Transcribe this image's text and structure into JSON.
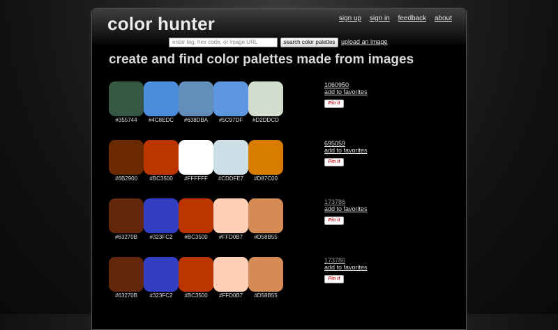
{
  "header": {
    "logo": "color hunter",
    "nav": [
      "sign up",
      "sign in",
      "feedback",
      "about"
    ]
  },
  "search": {
    "placeholder": "enter tag, hex code, or image URL",
    "button_label": "search color palettes",
    "upload_label": "upload an image"
  },
  "headline": "create and find color palettes made from images",
  "palettes": [
    {
      "count": "1060950",
      "count_color": "#e6e6e6",
      "favorite_label": "add to favorites",
      "pin_label": "Pin it",
      "colors": [
        "#355744",
        "#4C8EDC",
        "#638DBA",
        "#5C97DF",
        "#D2DDCD"
      ],
      "labels": [
        "#355744",
        "#4C8EDC",
        "#638DBA",
        "#5C97DF",
        "#D2DDCD"
      ]
    },
    {
      "count": "695059",
      "count_color": "#e6e6e6",
      "favorite_label": "add to favorites",
      "pin_label": "Pin it",
      "colors": [
        "#6B2900",
        "#BC3500",
        "#FFFFFF",
        "#CDDFE7",
        "#D87C00"
      ],
      "labels": [
        "#6B2900",
        "#BC3500",
        "#FFFFFF",
        "#CDDFE7",
        "#D87C00"
      ]
    },
    {
      "count": "173786",
      "count_color": "#9a9a9a",
      "favorite_label": "add to favorites",
      "pin_label": "Pin it",
      "colors": [
        "#63270B",
        "#323FC2",
        "#BC3500",
        "#FFD0B7",
        "#D58B55"
      ],
      "labels": [
        "#63270B",
        "#323FC2",
        "#BC3500",
        "#FFD0B7",
        "#D58B55"
      ]
    },
    {
      "count": "173786",
      "count_color": "#9a9a9a",
      "favorite_label": "add to favorites",
      "pin_label": "Pin it",
      "colors": [
        "#63270B",
        "#323FC2",
        "#BC3500",
        "#FFD0B7",
        "#D58B55"
      ],
      "labels": [
        "#63270B",
        "#323FC2",
        "#BC3500",
        "#FFD0B7",
        "#D58B55"
      ]
    }
  ]
}
